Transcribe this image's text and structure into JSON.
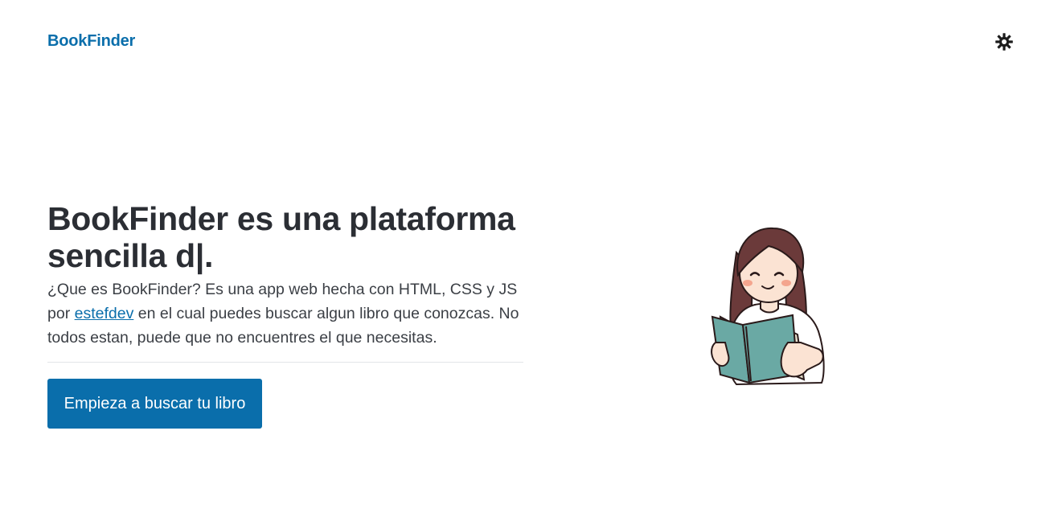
{
  "header": {
    "brand": "BookFinder",
    "theme_toggle_icon": "sun-icon"
  },
  "hero": {
    "title": "BookFinder es una plataforma sencilla d|.",
    "text_before_link": "¿Que es BookFinder? Es una app web hecha con HTML, CSS y JS por ",
    "author_link": "estefdev",
    "text_after_link": " en el cual puedes buscar algun libro que conozcas. No todos estan, puede que no encuentres el que necesitas.",
    "cta_label": "Empieza a buscar tu libro"
  },
  "illustration": {
    "icon": "girl-reading-book-illustration"
  },
  "colors": {
    "accent": "#0a6eab",
    "heading": "#2b2e34",
    "body_text": "#3b3f45",
    "book": "#6aa9a4",
    "hair": "#6b3a3a"
  }
}
